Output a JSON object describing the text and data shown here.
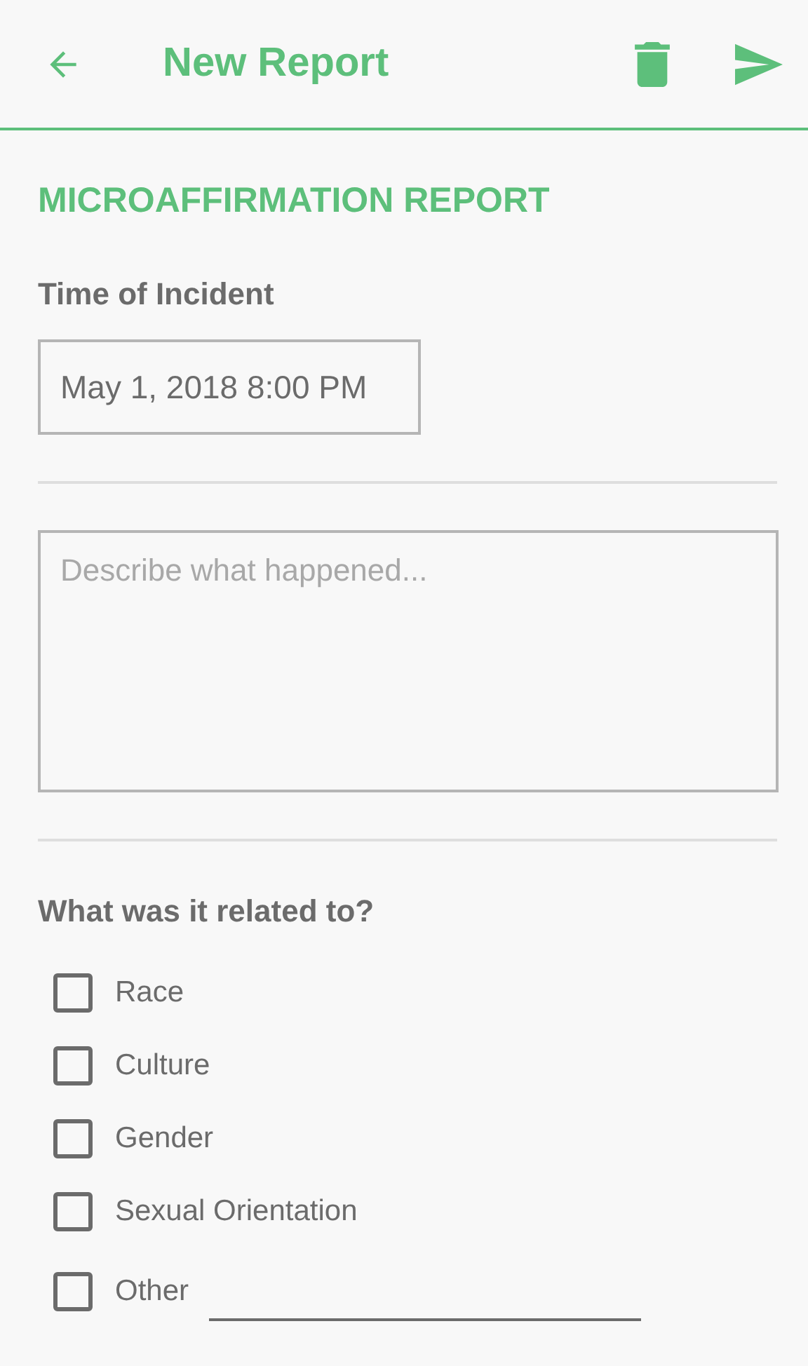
{
  "app_bar": {
    "title": "New Report"
  },
  "section_title": "MICROAFFIRMATION REPORT",
  "time_label": "Time of Incident",
  "time_value": "May 1, 2018 8:00 PM",
  "description": {
    "placeholder": "Describe what happened..."
  },
  "related_label": "What was it related to?",
  "options": [
    {
      "label": "Race",
      "checked": false,
      "kind": "checkbox"
    },
    {
      "label": "Culture",
      "checked": false,
      "kind": "checkbox"
    },
    {
      "label": "Gender",
      "checked": false,
      "kind": "checkbox"
    },
    {
      "label": "Sexual Orientation",
      "checked": false,
      "kind": "checkbox"
    },
    {
      "label": "Other",
      "checked": false,
      "kind": "other"
    }
  ]
}
